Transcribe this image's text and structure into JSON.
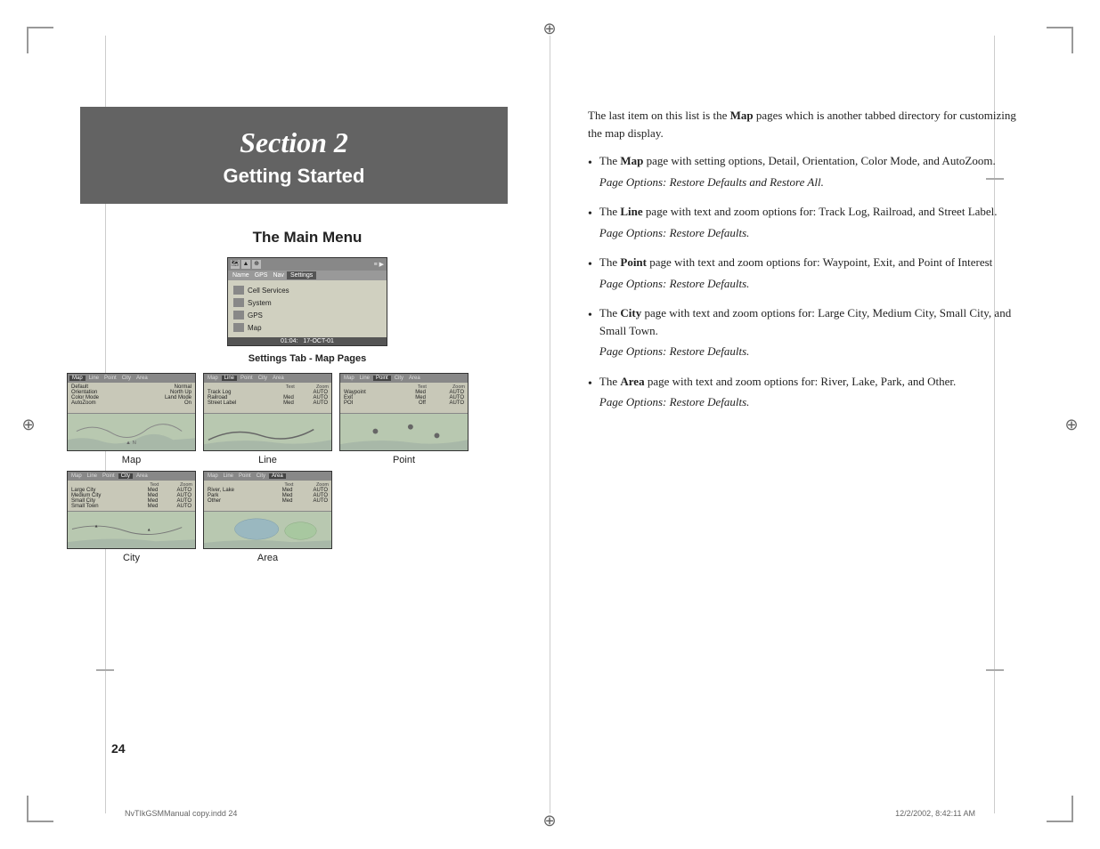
{
  "page": {
    "left_page_number": "24",
    "footer_left": "NvTIkGSMManual copy.indd   24",
    "footer_right": "12/2/2002, 8:42:11 AM"
  },
  "section": {
    "number": "Section 2",
    "title": "Getting Started"
  },
  "left_content": {
    "main_heading": "The Main Menu",
    "settings_tab_label": "Settings Tab - Map Pages",
    "map_labels": [
      "Map",
      "Line",
      "Point",
      "City",
      "Area"
    ],
    "gps_menu": {
      "tabs": [
        "Name",
        "GPS",
        "Nav",
        "Settings"
      ],
      "items": [
        "Cell Services",
        "System",
        "GPS",
        "Map"
      ],
      "footer": "01:04:   17-OCT-01"
    }
  },
  "right_content": {
    "intro": "The last item on this list is the Map pages which is another tabbed directory for customizing the map display.",
    "bullets": [
      {
        "bold_word": "Map",
        "text": " page with setting options, Detail, Orientation, Color Mode, and AutoZoom.",
        "page_options": "Page Options: Restore Defaults and Restore All."
      },
      {
        "bold_word": "Line",
        "text": " page with text and zoom options for: Track Log, Railroad, and Street Label.",
        "page_options": "Page Options: Restore Defaults."
      },
      {
        "bold_word": "Point",
        "text": " page with text and zoom options for: Waypoint, Exit, and Point of Interest",
        "page_options": "Page Options: Restore Defaults."
      },
      {
        "bold_word": "City",
        "text": " page with text and zoom options for: Large City, Medium City, Small City, and Small Town.",
        "page_options": "Page Options: Restore Defaults."
      },
      {
        "bold_word": "Area",
        "text": " page with text and zoom options for: River, Lake, Park, and Other.",
        "page_options": "Page Options: Restore Defaults."
      }
    ],
    "the_prefix": "The "
  },
  "map_pages": {
    "map": {
      "label": "Map",
      "rows": [
        {
          "name": "Default",
          "val": "Normal"
        },
        {
          "name": "Orientation",
          "val": "North Up"
        },
        {
          "name": "Color Mode",
          "val": "Land Mode"
        },
        {
          "name": "AutoZoom",
          "val": "On"
        }
      ],
      "active_tab": "Map"
    },
    "line": {
      "label": "Line",
      "headers": [
        "Text",
        "Zoom"
      ],
      "rows": [
        {
          "name": "Track Log",
          "text": "",
          "zoom": "AUTO"
        },
        {
          "name": "Railroad",
          "text": "Med",
          "zoom": "AUTO"
        },
        {
          "name": "Street Label",
          "text": "Med",
          "zoom": "AUTO"
        }
      ],
      "active_tab": "Line"
    },
    "point": {
      "label": "Point",
      "headers": [
        "Text",
        "Zoom"
      ],
      "rows": [
        {
          "name": "Waypoint",
          "text": "Med",
          "zoom": "AUTO"
        },
        {
          "name": "Exit",
          "text": "Med",
          "zoom": "AUTO"
        },
        {
          "name": "POI",
          "text": "Off",
          "zoom": "AUTO"
        }
      ],
      "active_tab": "Point"
    },
    "city": {
      "label": "City",
      "headers": [
        "Text",
        "Zoom"
      ],
      "rows": [
        {
          "name": "Large City",
          "text": "Med",
          "zoom": "AUTO"
        },
        {
          "name": "Med City",
          "text": "Med",
          "zoom": "AUTO"
        },
        {
          "name": "Small City",
          "text": "Med",
          "zoom": "AUTO"
        },
        {
          "name": "Small Town",
          "text": "Med",
          "zoom": "AUTO"
        }
      ],
      "active_tab": "City"
    },
    "area": {
      "label": "Area",
      "headers": [
        "Text",
        "Zoom"
      ],
      "rows": [
        {
          "name": "River, Lake",
          "text": "Med",
          "zoom": "AUTO"
        },
        {
          "name": "Park",
          "text": "Med",
          "zoom": "AUTO"
        },
        {
          "name": "Other",
          "text": "Med",
          "zoom": "AUTO"
        }
      ],
      "active_tab": "Area"
    }
  }
}
